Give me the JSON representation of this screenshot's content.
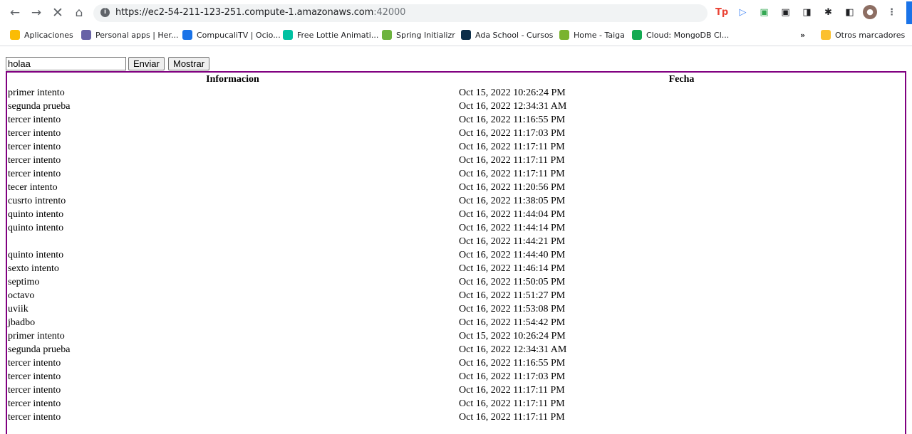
{
  "browser": {
    "url_main": "https://ec2-54-211-123-251.compute-1.amazonaws.com",
    "url_port": ":42000",
    "bookmarks": [
      {
        "label": "Aplicaciones",
        "icon": "apps-grid-icon",
        "color": "#fbbc04"
      },
      {
        "label": "Personal apps | Her...",
        "icon": "heroku-icon",
        "color": "#6762a6"
      },
      {
        "label": "CompucaliTV | Ocio...",
        "icon": "tv-icon",
        "color": "#1a73e8"
      },
      {
        "label": "Free Lottie Animati...",
        "icon": "lottie-icon",
        "color": "#00c1a2"
      },
      {
        "label": "Spring Initializr",
        "icon": "spring-icon",
        "color": "#6db33f"
      },
      {
        "label": "Ada School - Cursos",
        "icon": "ada-icon",
        "color": "#0c2d48"
      },
      {
        "label": "Home - Taiga",
        "icon": "taiga-icon",
        "color": "#7ab32e"
      },
      {
        "label": "Cloud: MongoDB Cl...",
        "icon": "mongodb-icon",
        "color": "#13aa52"
      }
    ],
    "more_label": "»",
    "other_bookmarks": "Otros marcadores"
  },
  "form": {
    "input_value": "holaa",
    "send_label": "Enviar",
    "show_label": "Mostrar"
  },
  "table": {
    "headers": [
      "Informacion",
      "Fecha"
    ],
    "rows": [
      [
        "primer intento",
        "Oct 15, 2022 10:26:24 PM"
      ],
      [
        "segunda prueba",
        "Oct 16, 2022 12:34:31 AM"
      ],
      [
        "tercer intento",
        "Oct 16, 2022 11:16:55 PM"
      ],
      [
        "tercer intento",
        "Oct 16, 2022 11:17:03 PM"
      ],
      [
        "tercer intento",
        "Oct 16, 2022 11:17:11 PM"
      ],
      [
        "tercer intento",
        "Oct 16, 2022 11:17:11 PM"
      ],
      [
        "tercer intento",
        "Oct 16, 2022 11:17:11 PM"
      ],
      [
        "tecer intento",
        "Oct 16, 2022 11:20:56 PM"
      ],
      [
        "cusrto intrento",
        "Oct 16, 2022 11:38:05 PM"
      ],
      [
        "quinto intento",
        "Oct 16, 2022 11:44:04 PM"
      ],
      [
        "quinto intento",
        "Oct 16, 2022 11:44:14 PM"
      ],
      [
        "",
        "Oct 16, 2022 11:44:21 PM"
      ],
      [
        "quinto intento",
        "Oct 16, 2022 11:44:40 PM"
      ],
      [
        "sexto intento",
        "Oct 16, 2022 11:46:14 PM"
      ],
      [
        "septimo",
        "Oct 16, 2022 11:50:05 PM"
      ],
      [
        "octavo",
        "Oct 16, 2022 11:51:27 PM"
      ],
      [
        "uviik",
        "Oct 16, 2022 11:53:08 PM"
      ],
      [
        "jbadbo",
        "Oct 16, 2022 11:54:42 PM"
      ],
      [
        "primer intento",
        "Oct 15, 2022 10:26:24 PM"
      ],
      [
        "segunda prueba",
        "Oct 16, 2022 12:34:31 AM"
      ],
      [
        "tercer intento",
        "Oct 16, 2022 11:16:55 PM"
      ],
      [
        "tercer intento",
        "Oct 16, 2022 11:17:03 PM"
      ],
      [
        "tercer intento",
        "Oct 16, 2022 11:17:11 PM"
      ],
      [
        "tercer intento",
        "Oct 16, 2022 11:17:11 PM"
      ],
      [
        "tercer intento",
        "Oct 16, 2022 11:17:11 PM"
      ]
    ]
  },
  "colors": {
    "table_border": "#800080",
    "profile_accent": "#1a73e8"
  }
}
